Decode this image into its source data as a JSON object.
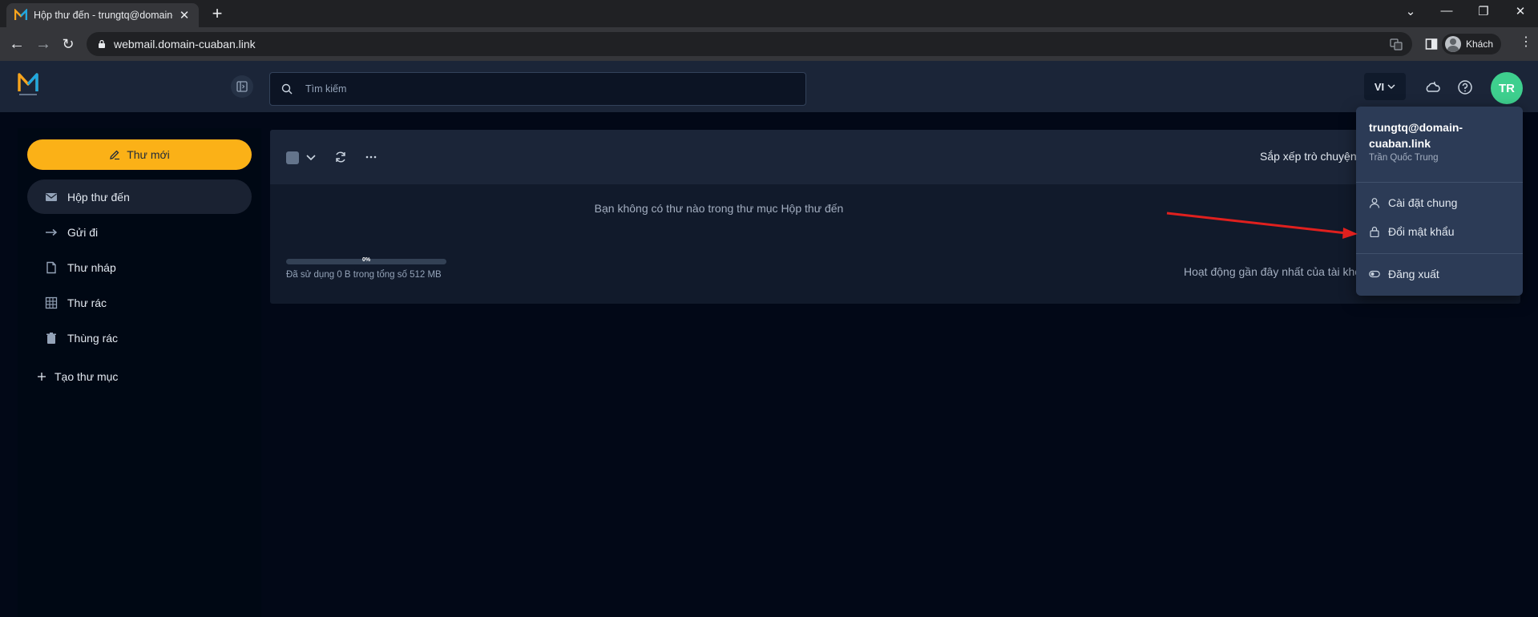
{
  "browser": {
    "tab_title": "Hộp thư đến - trungtq@domain-cuaban.link",
    "url": "webmail.domain-cuaban.link",
    "profile_label": "Khách"
  },
  "header": {
    "search_placeholder": "Tìm kiếm",
    "language": "VI",
    "avatar_initials": "TR"
  },
  "sidebar": {
    "compose_label": "Thư mới",
    "items": [
      {
        "label": "Hộp thư đến",
        "icon": "inbox-icon",
        "active": true
      },
      {
        "label": "Gửi đi",
        "icon": "sent-arrow-icon",
        "active": false
      },
      {
        "label": "Thư nháp",
        "icon": "draft-file-icon",
        "active": false
      },
      {
        "label": "Thư rác",
        "icon": "spam-grid-icon",
        "active": false
      },
      {
        "label": "Thùng rác",
        "icon": "trash-icon",
        "active": false
      }
    ],
    "new_folder_label": "Tạo thư mục"
  },
  "main": {
    "sort_label": "Sắp xếp trò chuyện:",
    "empty_message": "Bạn không có thư nào trong thư mục Hộp thư đến",
    "quota_percent_label": "0%",
    "quota_fraction": 0,
    "quota_text": "Đã sử dụng 0 B trong tổng số 512 MB",
    "activity_text": "Hoạt động gần đây nhất của tài khoản"
  },
  "user_menu": {
    "email": "trungtq@domain-cuaban.link",
    "name": "Trần Quốc Trung",
    "settings_label": "Cài đặt chung",
    "change_password_label": "Đổi mật khẩu",
    "logout_label": "Đăng xuất"
  },
  "colors": {
    "accent": "#fbb117",
    "avatar_bg": "#3ecf8e",
    "annotation_arrow": "#e0201e"
  }
}
